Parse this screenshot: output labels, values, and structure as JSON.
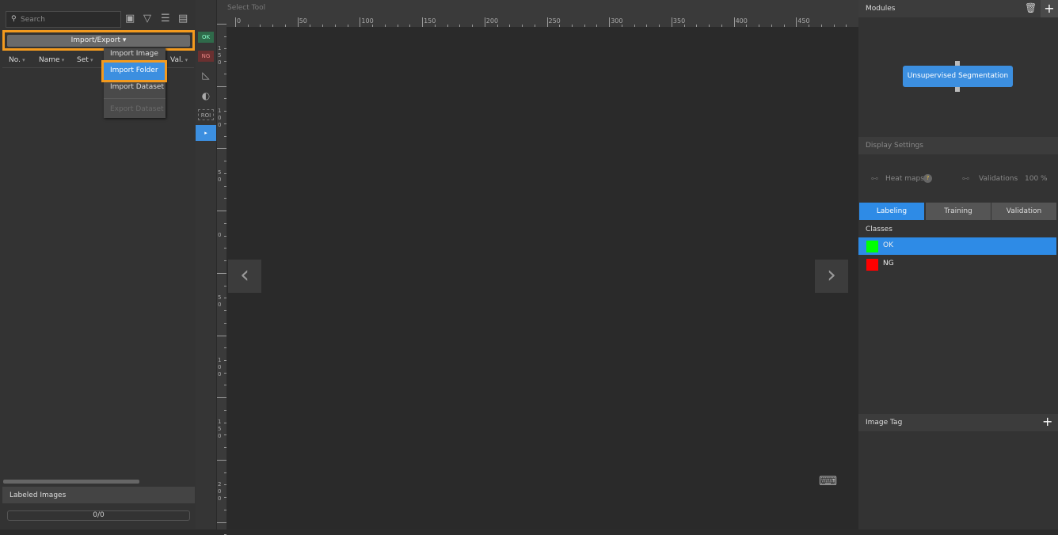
{
  "left_panel": {
    "search_placeholder": "Search",
    "toolbar_icons": [
      "image-settings-icon",
      "filter-icon",
      "list-icon",
      "split-icon"
    ],
    "import_export_label": "Import/Export ▾",
    "columns": [
      "No.",
      "Name",
      "Set",
      "Val."
    ],
    "menu": {
      "items": [
        {
          "label": "Import Image",
          "enabled": true
        },
        {
          "label": "Import Folder",
          "enabled": true,
          "highlighted": true
        },
        {
          "label": "Import Dataset",
          "enabled": true
        },
        {
          "label": "Export Dataset",
          "enabled": false
        }
      ]
    },
    "labeled_images_title": "Labeled Images",
    "labeled_progress": "0/0"
  },
  "tools": {
    "ok": "OK",
    "ng": "NG",
    "roi": "ROI"
  },
  "canvas": {
    "title": "Select Tool",
    "h_ruler_labels": [
      "0",
      "50",
      "100",
      "150",
      "200",
      "250",
      "300",
      "350",
      "400",
      "450"
    ],
    "v_ruler_labels": [
      "150",
      "100",
      "50",
      "0",
      "50",
      "100",
      "150",
      "200"
    ]
  },
  "right_panel": {
    "modules_title": "Modules",
    "module_node": "Unsupervised Segmentation",
    "display_settings_title": "Display Settings",
    "heat_maps_label": "Heat maps",
    "validations_label": "Validations",
    "validations_value": "100 %",
    "tabs": [
      {
        "label": "Labeling",
        "active": true
      },
      {
        "label": "Training"
      },
      {
        "label": "Validation"
      }
    ],
    "classes_title": "Classes",
    "classes": [
      {
        "name": "OK",
        "color": "#00ff00",
        "selected": true
      },
      {
        "name": "NG",
        "color": "#ff0000"
      }
    ],
    "image_tag_title": "Image Tag"
  },
  "colors": {
    "accent": "#3c8fe0",
    "highlight_border": "#f39a1e"
  }
}
